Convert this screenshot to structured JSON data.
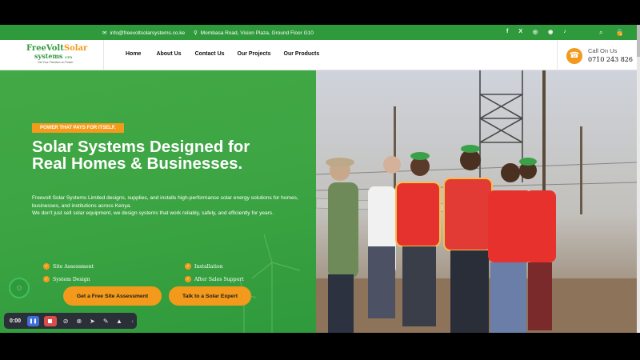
{
  "topbar": {
    "email": "info@freevoltsolarsystems.co.ke",
    "address": "Mombasa Road, Vision Plaza, Ground Floor G10",
    "social": [
      "f",
      "X",
      "◎",
      "◉",
      "♪"
    ],
    "cart_count": "0"
  },
  "logo": {
    "line1a": "FreeVolt",
    "line1b": "Solar",
    "line2": "systems",
    "line2b": "LTD",
    "tagline": "Get Your Freedom on Power"
  },
  "nav": [
    "Home",
    "About Us",
    "Contact Us",
    "Our Projects",
    "Our Products"
  ],
  "call": {
    "label": "Call On Us",
    "phone": "0710 243 826"
  },
  "hero": {
    "badge": "POWER THAT PAYS FOR ITSELF.",
    "title": "Solar Systems Designed for Real Homes & Businesses.",
    "desc1": "Freevolt Solar Systems Limited designs, supplies, and installs high-performance solar energy solutions for homes, businesses, and institutions across Kenya.",
    "desc2": "We don't just sell solar equipment, we design systems that work reliably, safely, and efficiently for years.",
    "features": [
      "Site Assessment",
      "Installation",
      "System Design",
      "After Sales Support"
    ],
    "btn_primary": "Get a Free Site Assessment",
    "btn_secondary": "Talk to a Solar Expert"
  },
  "recorder": {
    "time": "0:00"
  },
  "colors": {
    "brand_green": "#2f9a3c",
    "accent_orange": "#f39a1c"
  }
}
